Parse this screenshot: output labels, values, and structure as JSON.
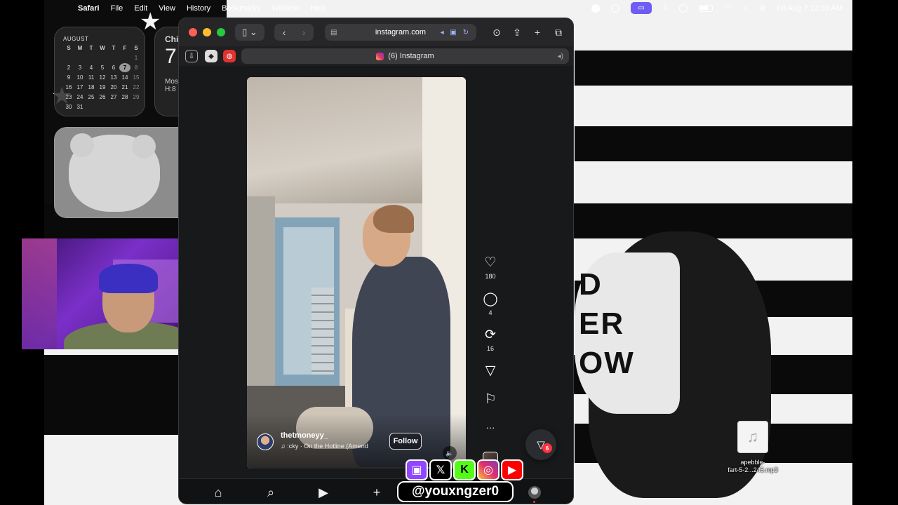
{
  "menubar": {
    "app_name": "Safari",
    "items": [
      "File",
      "Edit",
      "View",
      "History",
      "Bookmarks",
      "Window",
      "Help"
    ],
    "datetime": "Fri Aug 7  12:39 AM"
  },
  "calendar_widget": {
    "month": "AUGUST",
    "weekdays": [
      "S",
      "M",
      "T",
      "W",
      "T",
      "F",
      "S"
    ],
    "days": [
      "",
      "",
      "",
      "",
      "",
      "",
      "1",
      "2",
      "3",
      "4",
      "5",
      "6",
      "7",
      "8",
      "9",
      "10",
      "11",
      "12",
      "13",
      "14",
      "15",
      "16",
      "17",
      "18",
      "19",
      "20",
      "21",
      "22",
      "23",
      "24",
      "25",
      "26",
      "27",
      "28",
      "29",
      "30",
      "31",
      "",
      "",
      "",
      "",
      ""
    ],
    "today": "7"
  },
  "weather_widget": {
    "city": "Chi",
    "temp": "7",
    "condition": "Mos",
    "hilo": "H:8"
  },
  "safari": {
    "url": "instagram.com",
    "tab_title": "(6) Instagram"
  },
  "reel": {
    "username": "thetmoneyy_",
    "audio": "♫  :cky · On the Hotline (Amend",
    "follow_label": "Follow",
    "mute_icon": "🔈",
    "likes": "180",
    "comments": "4",
    "reposts": "16",
    "more": "···"
  },
  "dm": {
    "badge": "6"
  },
  "social_overlay": {
    "handle": "@youxngzer0",
    "platforms": [
      "twitch",
      "x",
      "kick",
      "instagram",
      "youtube"
    ]
  },
  "desktop_file": {
    "name": "apebble-\nfart-5-2...245.mp3"
  },
  "colors": {
    "accent_purple": "#6f5cf2",
    "notification_red": "#ff3040",
    "twitch": "#9146ff",
    "kick": "#53fc18",
    "youtube": "#ff0000"
  }
}
